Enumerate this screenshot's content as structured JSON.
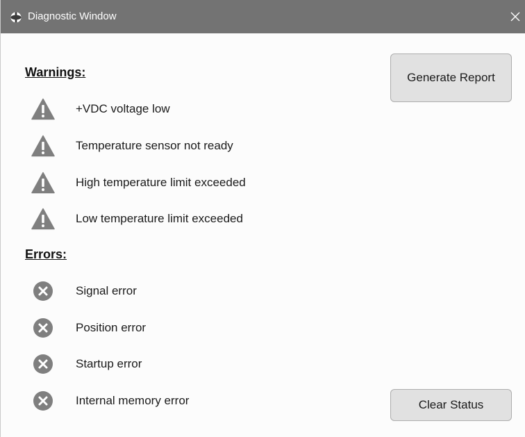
{
  "window": {
    "title": "Diagnostic Window",
    "close_glyph": "✕"
  },
  "warnings": {
    "heading": "Warnings:",
    "icon": "warning-triangle-icon",
    "items": [
      "+VDC voltage low",
      "Temperature sensor not ready",
      "High temperature limit exceeded",
      "Low temperature limit exceeded"
    ]
  },
  "errors": {
    "heading": "Errors:",
    "icon": "error-x-circle-icon",
    "items": [
      "Signal error",
      "Position error",
      "Startup error",
      "Internal memory error"
    ]
  },
  "actions": {
    "generate_report": "Generate Report",
    "clear_status": "Clear Status"
  },
  "colors": {
    "titlebar": "#737373",
    "icon_gray": "#7f7f7f",
    "button_bg": "#e1e1e1"
  }
}
